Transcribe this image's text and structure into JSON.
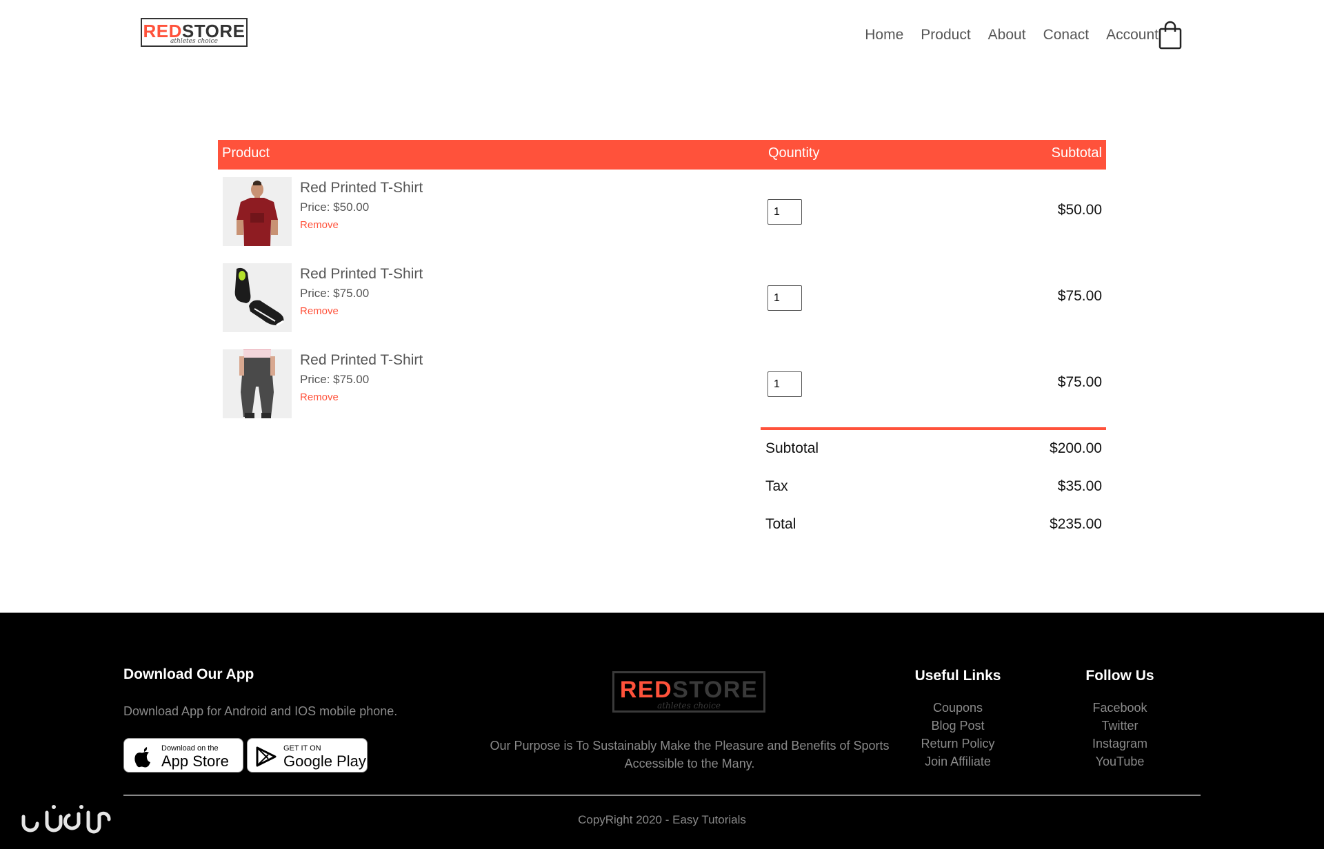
{
  "header": {
    "logo": {
      "text_red": "RED",
      "text_dark": "STORE",
      "tagline": "athletes choice"
    },
    "nav": [
      "Home",
      "Product",
      "About",
      "Conact",
      "Account"
    ],
    "cart_icon": "shopping-bag-icon"
  },
  "cart": {
    "columns": {
      "product": "Product",
      "quantity": "Qountity",
      "subtotal": "Subtotal"
    },
    "items": [
      {
        "name": "Red Printed T-Shirt",
        "price": "Price: $50.00",
        "remove": "Remove",
        "quantity": "1",
        "subtotal": "$50.00",
        "image": "red-tshirt-man"
      },
      {
        "name": "Red Printed T-Shirt",
        "price": "Price: $75.00",
        "remove": "Remove",
        "quantity": "1",
        "subtotal": "$75.00",
        "image": "black-sneakers"
      },
      {
        "name": "Red Printed T-Shirt",
        "price": "Price: $75.00",
        "remove": "Remove",
        "quantity": "1",
        "subtotal": "$75.00",
        "image": "grey-joggers"
      }
    ],
    "totals": [
      {
        "label": "Subtotal",
        "value": "$200.00"
      },
      {
        "label": "Tax",
        "value": "$35.00"
      },
      {
        "label": "Total",
        "value": "$235.00"
      }
    ]
  },
  "footer": {
    "app": {
      "heading": "Download Our App",
      "desc": "Download App for Android and IOS mobile phone.",
      "apple_small": "Download on the",
      "apple_big": "App Store",
      "google_small": "GET IT ON",
      "google_big": "Google Play"
    },
    "logo": {
      "text_red": "RED",
      "text_dark": "STORE",
      "tagline": "athletes choice"
    },
    "purpose": "Our Purpose is To Sustainably Make the Pleasure and Benefits of Sports Accessible to the Many.",
    "useful_links": {
      "heading": "Useful Links",
      "items": [
        "Coupons",
        "Blog Post",
        "Return Policy",
        "Join Affiliate"
      ]
    },
    "follow_us": {
      "heading": "Follow Us",
      "items": [
        "Facebook",
        "Twitter",
        "Instagram",
        "YouTube"
      ]
    },
    "copyright": "CopyRight 2020 - Easy Tutorials"
  },
  "colors": {
    "accent": "#ff523b",
    "footer_bg": "#000000",
    "text": "#555555"
  }
}
